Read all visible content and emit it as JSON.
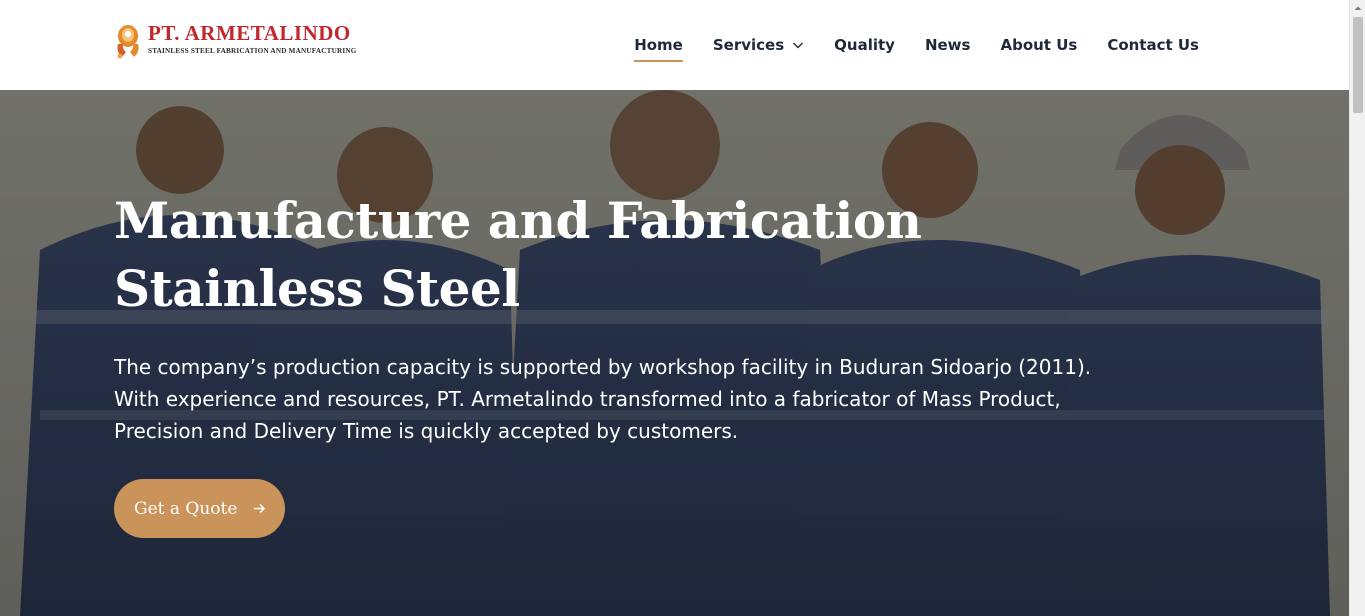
{
  "logo": {
    "title": "PT. ARMETALINDO",
    "subtitle": "STAINLESS STEEL FABRICATION AND MANUFACTURING",
    "icon": "armetalindo-logo-icon"
  },
  "nav": {
    "items": [
      {
        "label": "Home",
        "active": true
      },
      {
        "label": "Services",
        "dropdown": true
      },
      {
        "label": "Quality"
      },
      {
        "label": "News"
      },
      {
        "label": "About Us"
      },
      {
        "label": "Contact Us"
      }
    ]
  },
  "hero": {
    "title": "Manufacture and Fabrication Stainless Steel",
    "description": "The company’s production capacity is supported by workshop facility in Buduran Sidoarjo (2011). With experience and resources, PT. Armetalindo transformed into a fabricator of Mass Product, Precision and Delivery Time is quickly accepted by customers.",
    "cta_label": "Get a Quote",
    "cta_icon": "arrow-right-icon"
  },
  "colors": {
    "accent": "#c9935a",
    "logo_red": "#c0282e",
    "nav_text": "#1e2a3a"
  }
}
